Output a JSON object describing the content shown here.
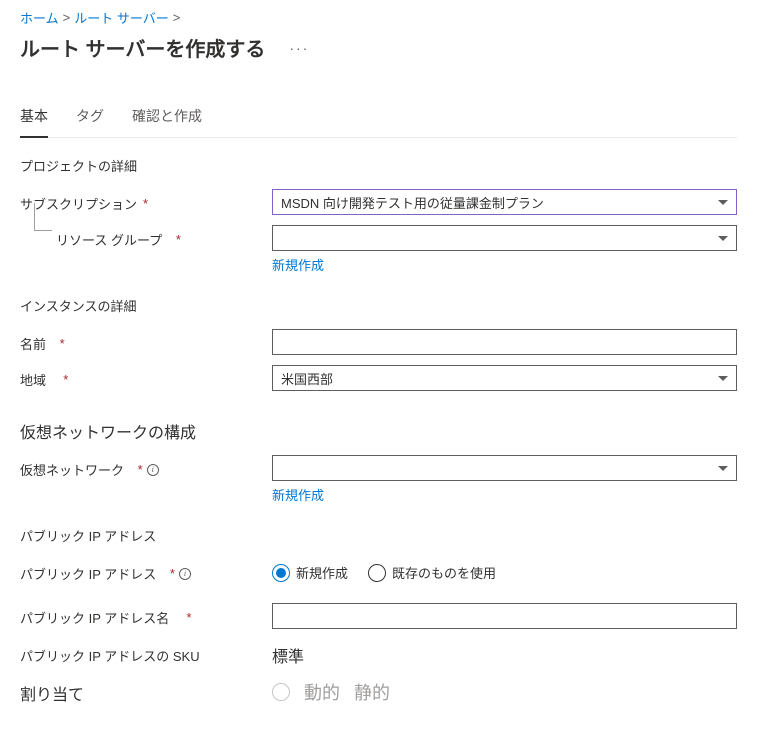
{
  "breadcrumb": {
    "home": "ホーム",
    "route_server": "ルート サーバー"
  },
  "page_title": "ルート サーバーを作成する",
  "more": "···",
  "tabs": {
    "basic": "基本",
    "tags": "タグ",
    "review": "確認と作成"
  },
  "sections": {
    "project_details": "プロジェクトの詳細",
    "instance_details": "インスタンスの詳細",
    "vnet_config": "仮想ネットワークの構成",
    "public_ip": "パブリック IP アドレス"
  },
  "fields": {
    "subscription": {
      "label": "サブスクリプション",
      "value": "MSDN 向け開発テスト用の従量課金制プラン"
    },
    "resource_group": {
      "label": "リソース グループ",
      "value": "",
      "create_new": "新規作成"
    },
    "name": {
      "label": "名前",
      "value": ""
    },
    "region": {
      "label": "地域",
      "value": "米国西部"
    },
    "vnet": {
      "label": "仮想ネットワーク",
      "value": "",
      "create_new": "新規作成"
    },
    "public_ip_address": {
      "label": "パブリック IP アドレス",
      "option_new": "新規作成",
      "option_existing": "既存のものを使用"
    },
    "public_ip_name": {
      "label": "パブリック IP アドレス名",
      "value": ""
    },
    "public_ip_sku": {
      "label": "パブリック IP アドレスの SKU",
      "value": "標準"
    },
    "allocation": {
      "label": "割り当て",
      "dynamic": "動的",
      "static": "静的"
    }
  },
  "req": "*"
}
